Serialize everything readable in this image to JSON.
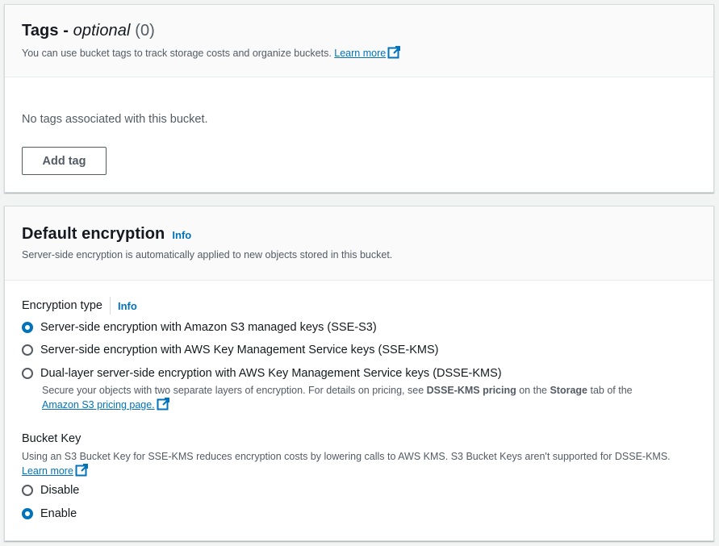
{
  "tags": {
    "title_prefix": "Tags - ",
    "title_optional": "optional",
    "title_count": " (0)",
    "description": "You can use bucket tags to track storage costs and organize buckets.",
    "learn_more": "Learn more",
    "empty_text": "No tags associated with this bucket.",
    "add_button": "Add tag"
  },
  "encryption": {
    "title": "Default encryption",
    "info": "Info",
    "description": "Server-side encryption is automatically applied to new objects stored in this bucket.",
    "type_label": "Encryption type",
    "type_info": "Info",
    "options": [
      {
        "label": "Server-side encryption with Amazon S3 managed keys (SSE-S3)",
        "selected": true
      },
      {
        "label": "Server-side encryption with AWS Key Management Service keys (SSE-KMS)",
        "selected": false
      },
      {
        "label": "Dual-layer server-side encryption with AWS Key Management Service keys (DSSE-KMS)",
        "selected": false
      }
    ],
    "dsse_desc_1": "Secure your objects with two separate layers of encryption. For details on pricing, see ",
    "dsse_bold_1": "DSSE-KMS pricing",
    "dsse_desc_2": " on the ",
    "dsse_bold_2": "Storage",
    "dsse_desc_3": " tab of the",
    "dsse_link": "Amazon S3 pricing page.",
    "bucket_key": {
      "label": "Bucket Key",
      "description": "Using an S3 Bucket Key for SSE-KMS reduces encryption costs by lowering calls to AWS KMS. S3 Bucket Keys aren't supported for DSSE-KMS.",
      "learn_more": "Learn more",
      "options": [
        {
          "label": "Disable",
          "selected": false
        },
        {
          "label": "Enable",
          "selected": true
        }
      ]
    }
  },
  "colors": {
    "link": "#0073bb",
    "text": "#16191f",
    "secondary": "#545b64",
    "background": "#f2f3f3"
  }
}
